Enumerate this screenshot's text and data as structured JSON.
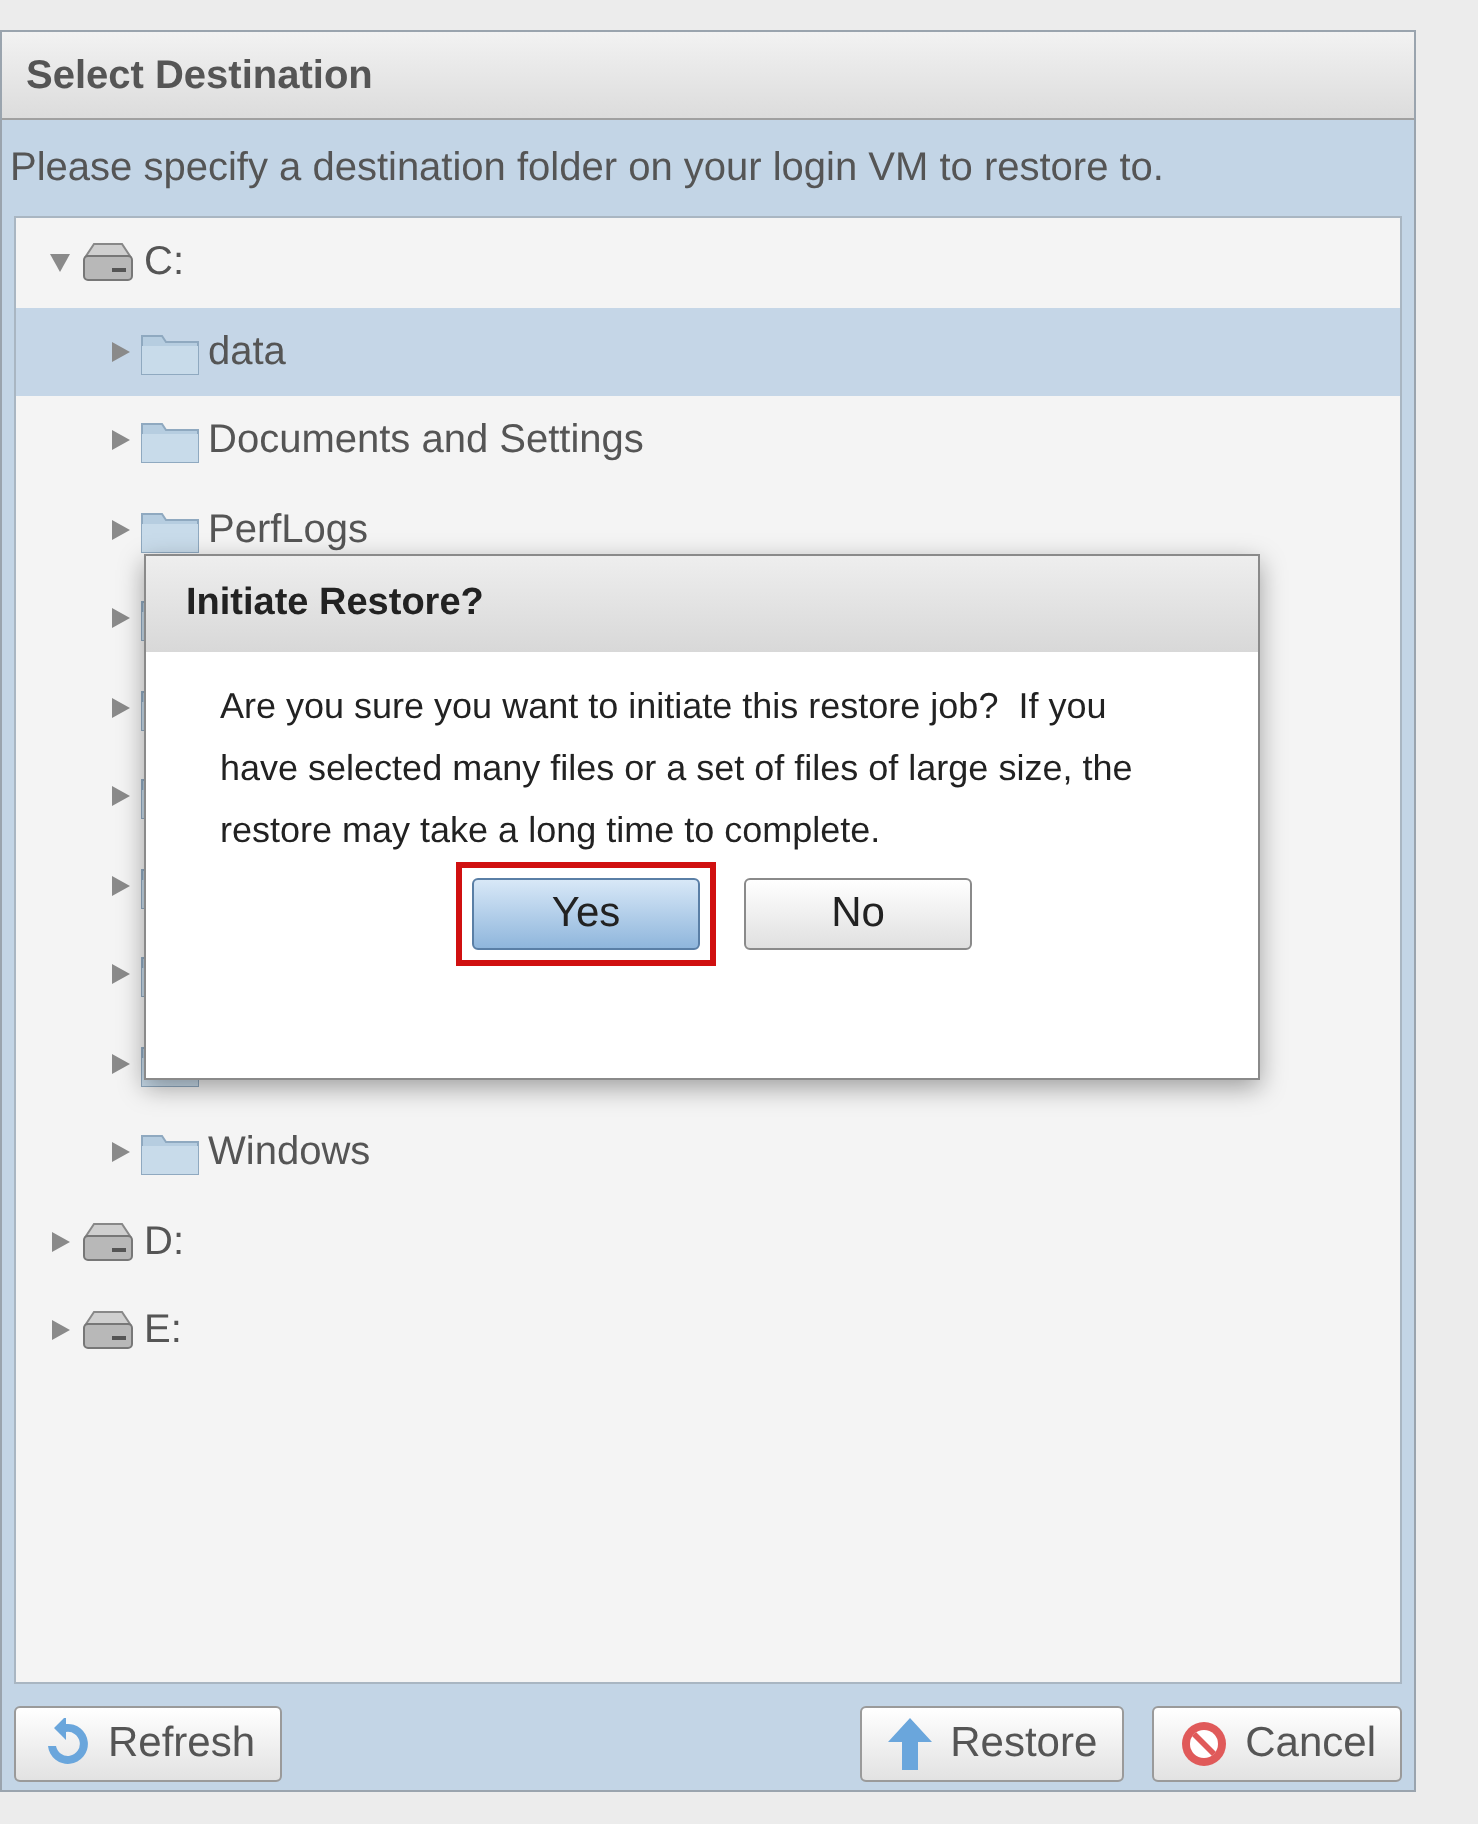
{
  "window": {
    "title": "Select Destination"
  },
  "instruction": "Please specify a destination folder on your login VM to restore to.",
  "tree": [
    {
      "kind": "drive",
      "label": "C:",
      "expanded": true,
      "selected": false,
      "children": [
        {
          "kind": "folder",
          "label": "data",
          "expanded": false,
          "selected": true
        },
        {
          "kind": "folder",
          "label": "Documents and Settings",
          "expanded": false,
          "selected": false
        },
        {
          "kind": "folder",
          "label": "PerfLogs",
          "expanded": false,
          "selected": false
        },
        {
          "kind": "folder",
          "expanded": false,
          "selected": false
        },
        {
          "kind": "folder",
          "expanded": false,
          "selected": false
        },
        {
          "kind": "folder",
          "expanded": false,
          "selected": false
        },
        {
          "kind": "folder",
          "expanded": false,
          "selected": false
        },
        {
          "kind": "folder",
          "expanded": false,
          "selected": false
        },
        {
          "kind": "folder",
          "expanded": false,
          "selected": false
        },
        {
          "kind": "folder",
          "label": "Windows",
          "expanded": false,
          "selected": false
        }
      ]
    },
    {
      "kind": "drive",
      "label": "D:",
      "expanded": false,
      "selected": false
    },
    {
      "kind": "drive",
      "label": "E:",
      "expanded": false,
      "selected": false
    }
  ],
  "buttons": [
    {
      "kind": "refresh",
      "label": "Refresh"
    },
    {
      "kind": "restore",
      "label": "Restore"
    },
    {
      "kind": "cancel",
      "label": "Cancel"
    }
  ],
  "dialog": {
    "title": "Initiate Restore?",
    "message": "Are you sure you want to initiate this restore job?  If you have selected many files or a set of files of large size, the restore may take a long time to complete.",
    "buttons": [
      {
        "label": "Yes",
        "selected": true,
        "highlighted": true
      },
      {
        "label": "No",
        "selected": false,
        "highlighted": false
      }
    ]
  }
}
